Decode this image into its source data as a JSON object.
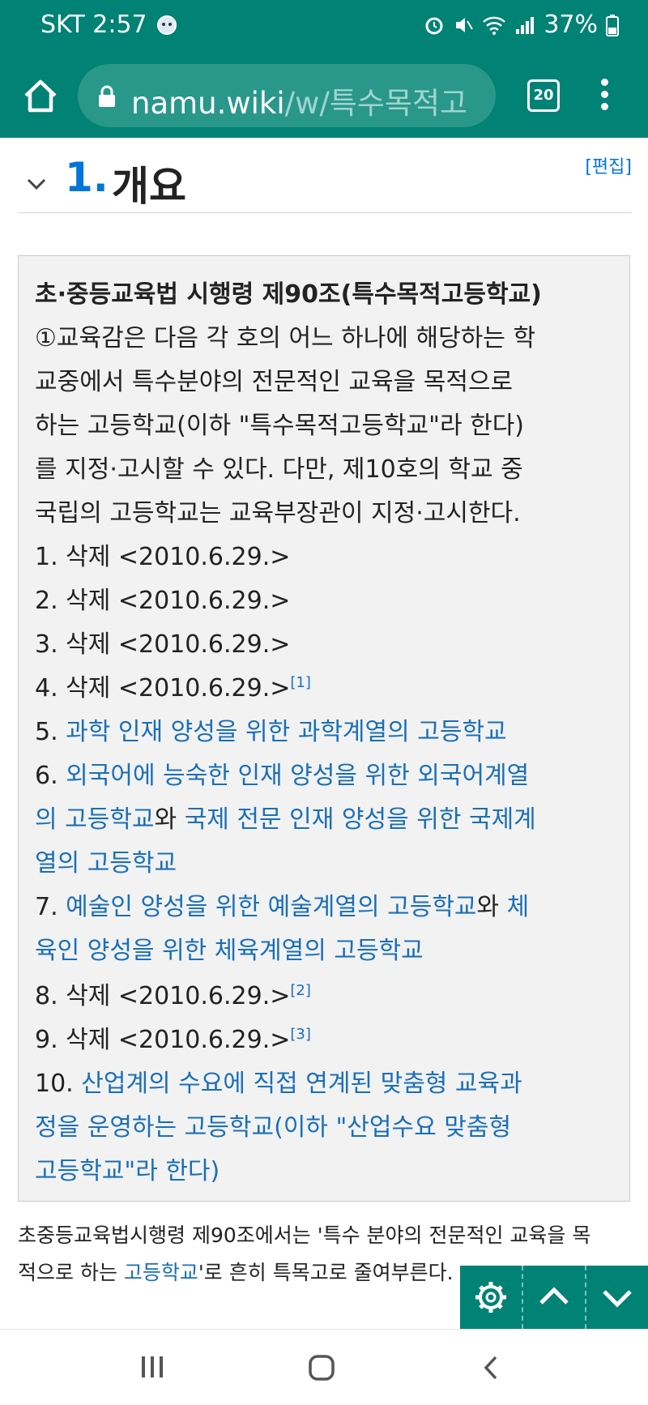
{
  "status_bar": {
    "carrier_time": "SKT 2:57",
    "battery": "37%",
    "icons": [
      "mascot-icon",
      "alarm-icon",
      "mute-icon",
      "wifi-icon",
      "signal-icon",
      "battery-icon"
    ]
  },
  "browser": {
    "url_host": "namu.wiki",
    "url_path": "/w/특수목적고",
    "tab_count": "20",
    "colors": {
      "toolbar": "#008275",
      "url_pill": "#2a978b"
    }
  },
  "section": {
    "number": "1.",
    "title": "개요",
    "edit_label": "[편집]"
  },
  "law_box": {
    "heading": "초·중등교육법 시행령 제90조(특수목적고등학교)",
    "lines": [
      "①교육감은 다음 각 호의 어느 하나에 해당하는 학",
      "교중에서 특수분야의 전문적인 교육을 목적으로",
      "하는 고등학교(이하 \"특수목적고등학교\"라 한다)",
      "를 지정·고시할 수 있다. 다만, 제10호의 학교 중",
      "국립의 고등학교는 교육부장관이 지정·고시한다."
    ],
    "items": {
      "i1": "1. 삭제 <2010.6.29.>",
      "i2": "2. 삭제 <2010.6.29.>",
      "i3": "3. 삭제 <2010.6.29.>",
      "i4": "4. 삭제 <2010.6.29.>",
      "i4_sup": "[1]",
      "i5_num": "5. ",
      "i5_link": "과학 인재 양성을 위한 과학계열의 고등학교",
      "i6_num": "6. ",
      "i6_link_a": "외국어에 능숙한 인재 양성을 위한 외국어계열",
      "i6_link_b": "의 고등학교",
      "i6_mid": "와 ",
      "i6_link_c": "국제 전문 인재 양성을 위한 국제계",
      "i6_link_d": "열의 고등학교",
      "i7_num": "7. ",
      "i7_link_a": "예술인 양성을 위한 예술계열의 고등학교",
      "i7_mid": "와 ",
      "i7_link_b": "체",
      "i7_link_c": "육인 양성을 위한 체육계열의 고등학교",
      "i8": "8. 삭제 <2010.6.29.>",
      "i8_sup": "[2]",
      "i9": "9. 삭제 <2010.6.29.>",
      "i9_sup": "[3]",
      "i10_num": "10. ",
      "i10_link_a": "산업계의 수요에 직접 연계된 맞춤형 교육과",
      "i10_link_b": "정을 운영하는 고등학교(이하 \"산업수요 맞춤형",
      "i10_link_c": "고등학교\"라 한다)"
    }
  },
  "paragraph": {
    "line1": "초중등교육법시행령 제90조에서는 '특수 분야의 전문적인 교육을 목",
    "line2_a": "적으로 하는 ",
    "line2_link": "고등학교",
    "line2_b": "'로 흔히 특목고로 줄여부른다."
  },
  "floating_controls": [
    "settings-icon",
    "scroll-up-icon",
    "scroll-down-icon"
  ],
  "nav_bar": [
    "recent-apps-icon",
    "home-icon",
    "back-icon"
  ]
}
